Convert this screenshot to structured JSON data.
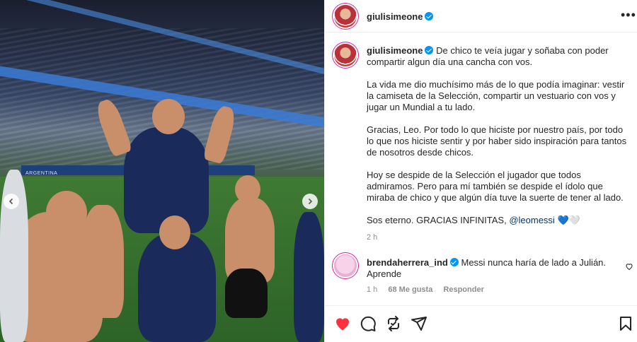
{
  "post": {
    "username": "giulisimeone",
    "more_label": "•••",
    "photo_banner": "ARGENTINA"
  },
  "caption": {
    "username": "giulisimeone",
    "paragraphs": [
      "De chico te veía jugar y soñaba con poder compartir algun día una cancha con vos.",
      "La vida me dio muchísimo más de lo que podía imaginar: vestir la camiseta de la Selección, compartir un vestuario con vos y jugar un Mundial a tu lado.",
      "Gracias, Leo. Por todo lo que hiciste por nuestro país, por todo lo que nos hiciste sentir y por haber sido inspiración para tantos de nosotros desde chicos.",
      "Hoy se despide de la Selección el jugador que todos admiramos. Pero para mí también se despide el ídolo que miraba de chico y que algún día tuve la suerte de tener al lado."
    ],
    "closing_text": "Sos eterno. GRACIAS INFINITAS, ",
    "mention": "@leomessi",
    "emojis": " 💙🤍",
    "time": "2 h"
  },
  "comment": {
    "username": "brendaherrera_ind",
    "text": "Messi nunca haría de lado a Julián. Aprende",
    "time": "1 h",
    "likes": "68 Me gusta",
    "reply_label": "Responder"
  },
  "icons": {
    "like": "heart-icon",
    "comment": "comment-icon",
    "repost": "repost-icon",
    "share": "share-icon",
    "save": "bookmark-icon"
  },
  "colors": {
    "like_red": "#ff3040",
    "verified_blue": "#0095f6",
    "mention": "#00376b"
  }
}
